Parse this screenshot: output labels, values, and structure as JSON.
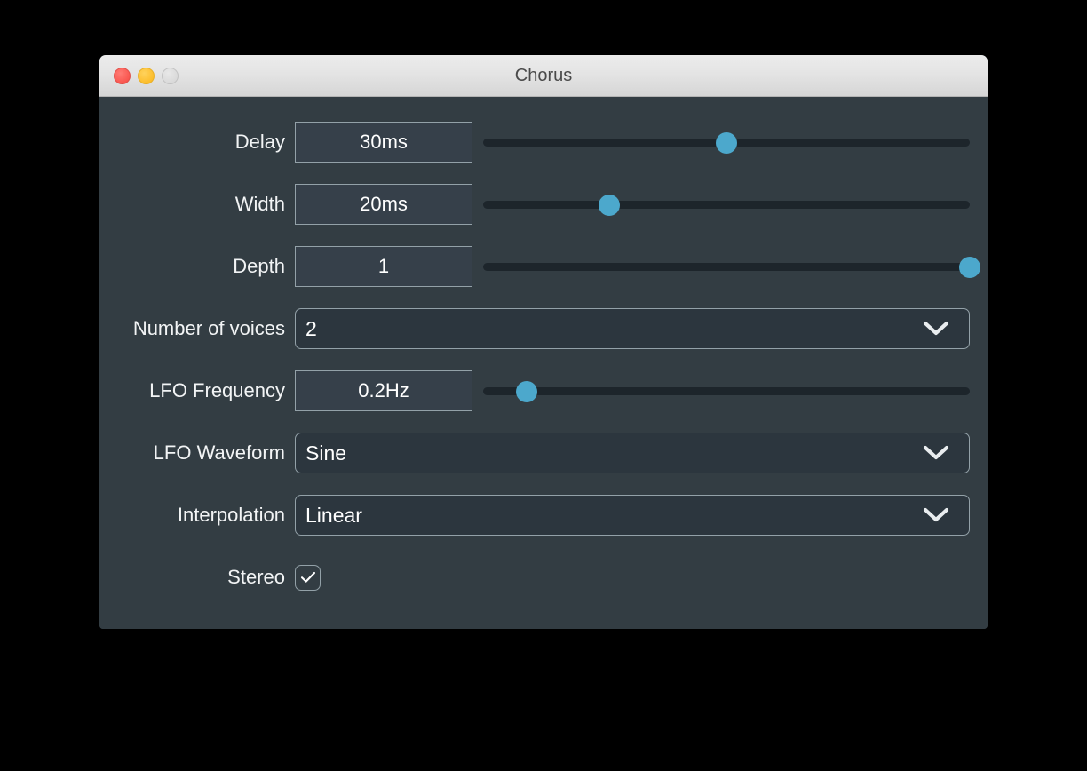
{
  "window": {
    "title": "Chorus",
    "controls": [
      {
        "name": "close-button",
        "label": "close"
      },
      {
        "name": "minimize-button",
        "label": "minimize"
      },
      {
        "name": "zoom-button",
        "label": "zoom"
      }
    ]
  },
  "colors": {
    "window_background": "#333d43",
    "titlebar_top": "#ececec",
    "titlebar_bottom": "#d6d6d6",
    "accent_thumb": "#4ca8cc",
    "slider_track": "#1d252b",
    "field_fill": "#36404a",
    "dropdown_fill": "#2c363e",
    "border": "#93a1a8",
    "text": "#ffffff",
    "desktop": "#000000"
  },
  "params": {
    "delay": {
      "label": "Delay",
      "value": "30ms",
      "slider_percent": 50
    },
    "width": {
      "label": "Width",
      "value": "20ms",
      "slider_percent": 26
    },
    "depth": {
      "label": "Depth",
      "value": "1",
      "slider_percent": 100
    },
    "voices": {
      "label": "Number of voices",
      "value": "2",
      "icon": "chevron-down-icon"
    },
    "lfo_frequency": {
      "label": "LFO Frequency",
      "value": "0.2Hz",
      "slider_percent": 9
    },
    "lfo_waveform": {
      "label": "LFO Waveform",
      "value": "Sine",
      "icon": "chevron-down-icon"
    },
    "interpolation": {
      "label": "Interpolation",
      "value": "Linear",
      "icon": "chevron-down-icon"
    },
    "stereo": {
      "label": "Stereo",
      "checked": true,
      "icon": "check-icon"
    }
  }
}
